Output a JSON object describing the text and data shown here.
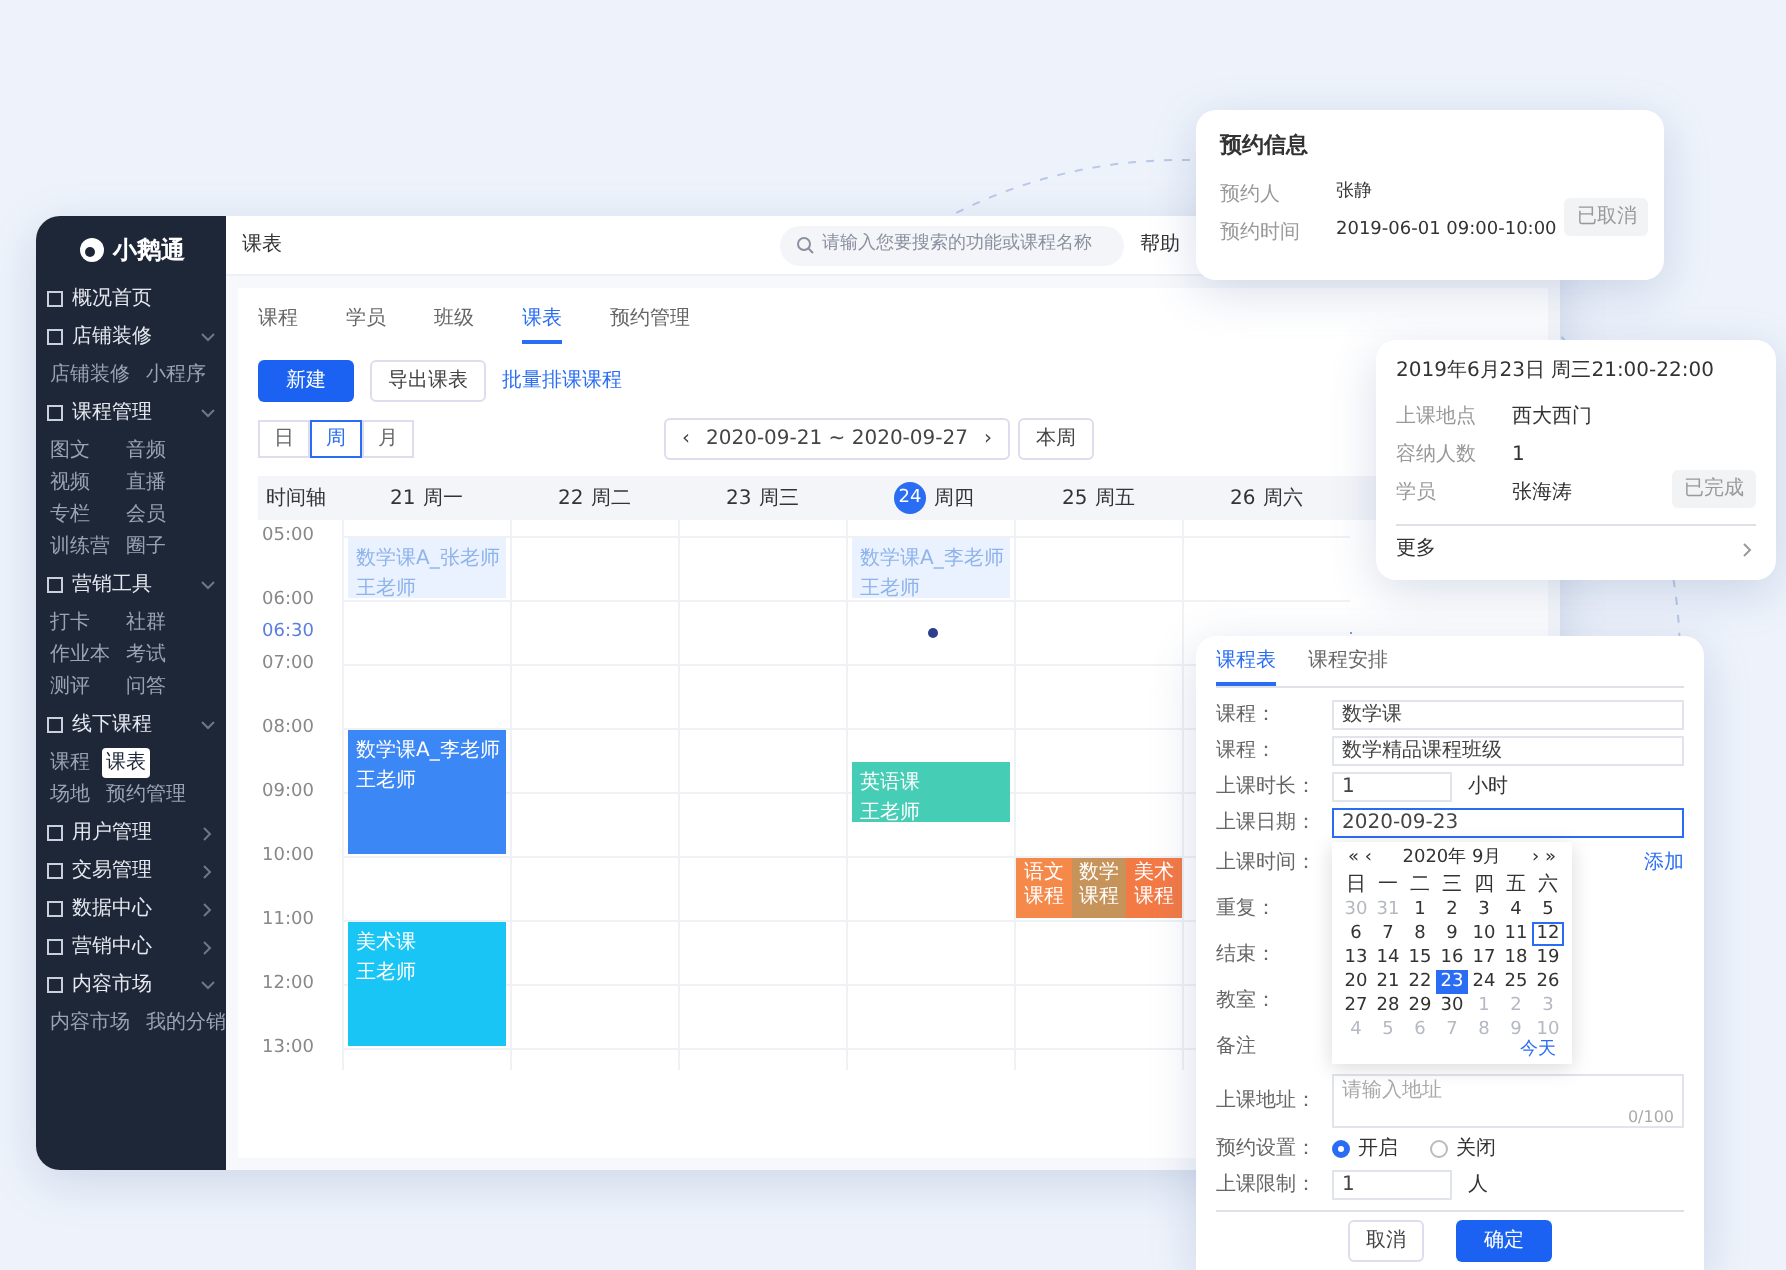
{
  "sidebar": {
    "logo": "小鹅通",
    "groups": [
      {
        "label": "概况首页"
      },
      {
        "label": "店铺装修",
        "expanded": true,
        "children": [
          {
            "label": "店铺装修",
            "selected": false
          },
          {
            "label": "小程序",
            "selected": false
          }
        ]
      },
      {
        "label": "课程管理",
        "expanded": true,
        "children": [
          {
            "label": "图文",
            "selected": false
          },
          {
            "label": "音频",
            "selected": false
          },
          {
            "label": "视频",
            "selected": false
          },
          {
            "label": "直播",
            "selected": false
          },
          {
            "label": "专栏",
            "selected": false
          },
          {
            "label": "会员",
            "selected": false
          },
          {
            "label": "训练营",
            "selected": false
          },
          {
            "label": "圈子",
            "selected": false
          }
        ]
      },
      {
        "label": "营销工具",
        "expanded": true,
        "children": [
          {
            "label": "打卡",
            "selected": false
          },
          {
            "label": "社群",
            "selected": false
          },
          {
            "label": "作业本",
            "selected": false
          },
          {
            "label": "考试",
            "selected": false
          },
          {
            "label": "测评",
            "selected": false
          },
          {
            "label": "问答",
            "selected": false
          }
        ]
      },
      {
        "label": "线下课程",
        "expanded": true,
        "children": [
          {
            "label": "课程",
            "selected": false
          },
          {
            "label": "课表",
            "selected": true
          },
          {
            "label": "场地",
            "selected": false
          },
          {
            "label": "预约管理",
            "selected": false
          }
        ]
      },
      {
        "label": "用户管理",
        "expanded": false
      },
      {
        "label": "交易管理",
        "expanded": false
      },
      {
        "label": "数据中心",
        "expanded": false
      },
      {
        "label": "营销中心",
        "expanded": false
      },
      {
        "label": "内容市场",
        "expanded": true,
        "children": [
          {
            "label": "内容市场",
            "selected": false
          },
          {
            "label": "我的分销",
            "selected": false
          }
        ]
      }
    ]
  },
  "topbar": {
    "breadcrumb": "课表",
    "search": {
      "placeholder": "请输入您要搜索的功能或课程名称"
    },
    "help": "帮助"
  },
  "tabs": [
    {
      "label": "课程",
      "selected": false
    },
    {
      "label": "学员",
      "selected": false
    },
    {
      "label": "班级",
      "selected": false
    },
    {
      "label": "课表",
      "selected": true
    },
    {
      "label": "预约管理",
      "selected": false
    }
  ],
  "actions": {
    "primary": "新建",
    "secondary": "导出课表",
    "link": "批量排课课程"
  },
  "view_modes": [
    {
      "label": "日",
      "selected": false
    },
    {
      "label": "周",
      "selected": true
    },
    {
      "label": "月",
      "selected": false
    }
  ],
  "date_range": {
    "prev": "‹",
    "range": "2020-09-21 ~ 2020-09-27",
    "next": "›",
    "current": "本周"
  },
  "calendar": {
    "axis_label": "时间轴",
    "now": "06:30",
    "days": [
      {
        "date": "21",
        "weekday": "周一",
        "today": false
      },
      {
        "date": "22",
        "weekday": "周二",
        "today": false
      },
      {
        "date": "23",
        "weekday": "周三",
        "today": false
      },
      {
        "date": "24",
        "weekday": "周四",
        "today": true
      },
      {
        "date": "25",
        "weekday": "周五",
        "today": false
      },
      {
        "date": "26",
        "weekday": "周六",
        "today": false
      }
    ],
    "rows": [
      {
        "time": "05:00",
        "cells": [
          {
            "kind": "one_hour",
            "faded": true,
            "color": "#e9f2fe",
            "title": "数学课A_张老师",
            "teacher": "王老师"
          },
          {
            "kind": "empty"
          },
          {
            "kind": "empty"
          },
          {
            "kind": "one_hour",
            "faded": true,
            "color": "#e9f2fe",
            "title": "数学课A_李老师",
            "teacher": "王老师"
          },
          {
            "kind": "empty"
          },
          {
            "kind": "empty"
          }
        ]
      },
      {
        "time": "06:00"
      },
      {
        "time": "07:00"
      },
      {
        "time": "08:00",
        "cells": [
          {
            "kind": "two_hours",
            "faded": false,
            "color": "#3b87f5",
            "title": "数学课A_李老师",
            "teacher": "王老师"
          },
          {
            "kind": "empty"
          },
          {
            "kind": "empty"
          },
          {
            "kind": "half_past_one_hour",
            "faded": false,
            "color": "#45cdb6",
            "title": "英语课",
            "teacher": "王老师"
          },
          {
            "kind": "empty"
          },
          {
            "kind": "empty"
          }
        ]
      },
      {
        "time": "09:00"
      },
      {
        "time": "10:00",
        "cells": [
          {
            "kind": "empty"
          },
          {
            "kind": "empty"
          },
          {
            "kind": "empty"
          },
          {
            "kind": "empty"
          },
          {
            "kind": "split",
            "parts": [
              {
                "title": "语文课程",
                "color": "#f5894a"
              },
              {
                "title": "数学课程",
                "color": "#c6935a"
              },
              {
                "title": "美术课程",
                "color": "#f47a45"
              }
            ]
          },
          {
            "kind": "empty"
          }
        ]
      },
      {
        "time": "11:00",
        "cells": [
          {
            "kind": "two_hours",
            "faded": false,
            "color": "#19c5f5",
            "title": "美术课",
            "teacher": "王老师"
          },
          {
            "kind": "empty"
          },
          {
            "kind": "empty"
          },
          {
            "kind": "empty"
          },
          {
            "kind": "empty"
          },
          {
            "kind": "empty"
          }
        ]
      },
      {
        "time": "12:00"
      },
      {
        "time": "13:00"
      }
    ]
  },
  "booking_card": {
    "title": "预约信息",
    "fields": [
      {
        "label": "预约人",
        "value": "张静"
      },
      {
        "label": "预约时间",
        "value": "2019-06-01 09:00-10:00"
      }
    ],
    "status": "已取消"
  },
  "lesson_card": {
    "title": "2019年6月23日 周三21:00-22:00",
    "fields": [
      {
        "label": "上课地点",
        "value": "西大西门"
      },
      {
        "label": "容纳人数",
        "value": "1"
      },
      {
        "label": "学员",
        "value": "张海涛"
      }
    ],
    "status": "已完成",
    "footer": "更多"
  },
  "form_panel": {
    "tabs": [
      {
        "label": "课程表",
        "selected": true
      },
      {
        "label": "课程安排",
        "selected": false
      }
    ],
    "fields": [
      {
        "kind": "select",
        "label": "课程：",
        "value": "数学课"
      },
      {
        "kind": "input",
        "label": "课程：",
        "value": "数学精品课程班级"
      },
      {
        "kind": "number",
        "label": "上课时长：",
        "value": "1",
        "unit": "小时"
      },
      {
        "kind": "date",
        "label": "上课日期：",
        "value": "2020-09-23"
      },
      {
        "kind": "label",
        "label": "上课时间：",
        "link": "添加"
      },
      {
        "kind": "label",
        "label": "重复："
      },
      {
        "kind": "label",
        "label": "结束："
      },
      {
        "kind": "label",
        "label": "教室："
      },
      {
        "kind": "label",
        "label": "备注"
      },
      {
        "kind": "textarea",
        "label": "上课地址：",
        "placeholder": "请输入地址",
        "counter": "0/100"
      },
      {
        "kind": "radio",
        "label": "预约设置：",
        "options": [
          {
            "label": "开启",
            "selected": true
          },
          {
            "label": "关闭",
            "selected": false
          }
        ]
      },
      {
        "kind": "number",
        "label": "上课限制：",
        "value": "1",
        "unit": "人"
      }
    ],
    "datepicker": {
      "prev": "« ‹",
      "header": "2020年 9月",
      "next": "› »",
      "weekdays": [
        "日",
        "一",
        "二",
        "三",
        "四",
        "五",
        "六"
      ],
      "weeks": [
        [
          {
            "d": "30",
            "muted": true
          },
          {
            "d": "31",
            "muted": true
          },
          {
            "d": "1",
            "muted": false
          },
          {
            "d": "2",
            "muted": false
          },
          {
            "d": "3",
            "muted": false
          },
          {
            "d": "4",
            "muted": false
          },
          {
            "d": "5",
            "muted": false
          }
        ],
        [
          {
            "d": "6",
            "muted": false
          },
          {
            "d": "7",
            "muted": false
          },
          {
            "d": "8",
            "muted": false
          },
          {
            "d": "9",
            "muted": false
          },
          {
            "d": "10",
            "muted": false
          },
          {
            "d": "11",
            "muted": false
          },
          {
            "d": "12",
            "muted": false,
            "today": true
          }
        ],
        [
          {
            "d": "13",
            "muted": false
          },
          {
            "d": "14",
            "muted": false
          },
          {
            "d": "15",
            "muted": false
          },
          {
            "d": "16",
            "muted": false
          },
          {
            "d": "17",
            "muted": false
          },
          {
            "d": "18",
            "muted": false
          },
          {
            "d": "19",
            "muted": false
          }
        ],
        [
          {
            "d": "20",
            "muted": false
          },
          {
            "d": "21",
            "muted": false
          },
          {
            "d": "22",
            "muted": false
          },
          {
            "d": "23",
            "muted": false,
            "selected": true
          },
          {
            "d": "24",
            "muted": false
          },
          {
            "d": "25",
            "muted": false
          },
          {
            "d": "26",
            "muted": false
          }
        ],
        [
          {
            "d": "27",
            "muted": false
          },
          {
            "d": "28",
            "muted": false
          },
          {
            "d": "29",
            "muted": false
          },
          {
            "d": "30",
            "muted": false
          },
          {
            "d": "1",
            "muted": true
          },
          {
            "d": "2",
            "muted": true
          },
          {
            "d": "3",
            "muted": true
          }
        ],
        [
          {
            "d": "4",
            "muted": true
          },
          {
            "d": "5",
            "muted": true
          },
          {
            "d": "6",
            "muted": true
          },
          {
            "d": "7",
            "muted": true
          },
          {
            "d": "8",
            "muted": true
          },
          {
            "d": "9",
            "muted": true
          },
          {
            "d": "10",
            "muted": true
          }
        ]
      ],
      "footer": "今天"
    },
    "buttons": {
      "cancel": "取消",
      "ok": "确定"
    }
  }
}
